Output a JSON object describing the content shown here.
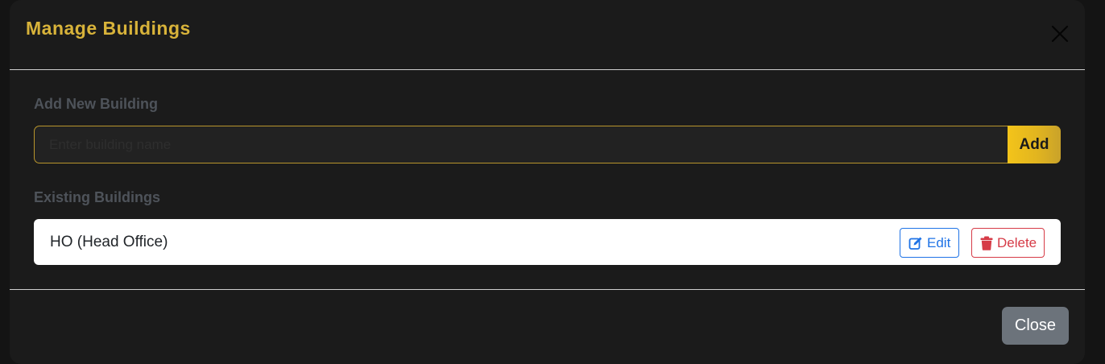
{
  "modal": {
    "title": "Manage Buildings",
    "close_icon": "close-icon"
  },
  "add_section": {
    "label": "Add New Building",
    "input_placeholder": "Enter building name",
    "input_value": "",
    "add_label": "Add"
  },
  "existing_section": {
    "label": "Existing Buildings",
    "buildings": [
      {
        "name": "HO (Head Office)",
        "edit_label": "Edit",
        "edit_icon": "edit-icon",
        "delete_label": "Delete",
        "delete_icon": "trash-icon"
      }
    ]
  },
  "footer": {
    "close_label": "Close"
  },
  "colors": {
    "accent": "#d8b33a",
    "add_button": "#e2b51f",
    "edit": "#1f73e6",
    "delete": "#d63b47",
    "close_button": "#6c737b",
    "background": "#1b1b1b"
  }
}
